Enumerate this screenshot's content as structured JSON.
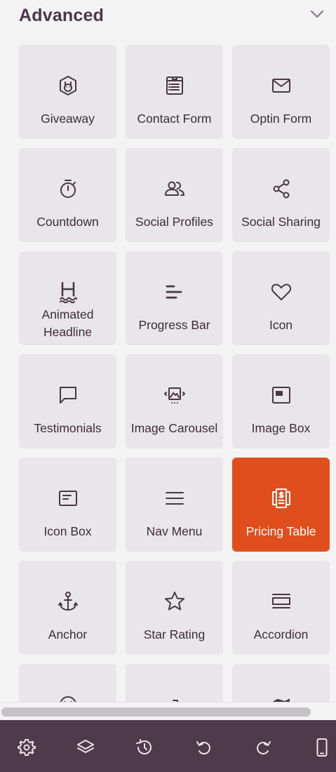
{
  "section": {
    "title": "Advanced",
    "collapse_icon": "chevron-down-icon"
  },
  "blocks": [
    {
      "label": "Giveaway",
      "icon": "giveaway-icon",
      "active": false
    },
    {
      "label": "Contact Form",
      "icon": "contact-form-icon",
      "active": false
    },
    {
      "label": "Optin Form",
      "icon": "envelope-icon",
      "active": false
    },
    {
      "label": "Countdown",
      "icon": "stopwatch-icon",
      "active": false
    },
    {
      "label": "Social Profiles",
      "icon": "people-icon",
      "active": false
    },
    {
      "label": "Social Sharing",
      "icon": "share-icon",
      "active": false
    },
    {
      "label_lines": [
        "Animated",
        "Headline"
      ],
      "icon": "animated-headline-icon",
      "active": false
    },
    {
      "label": "Progress Bar",
      "icon": "progress-bar-icon",
      "active": false
    },
    {
      "label": "Icon",
      "icon": "heart-icon",
      "active": false
    },
    {
      "label": "Testimonials",
      "icon": "speech-bubble-icon",
      "active": false
    },
    {
      "label": "Image Carousel",
      "icon": "image-carousel-icon",
      "active": false
    },
    {
      "label": "Image Box",
      "icon": "image-box-icon",
      "active": false
    },
    {
      "label": "Icon Box",
      "icon": "icon-box-icon",
      "active": false
    },
    {
      "label": "Nav Menu",
      "icon": "hamburger-menu-icon",
      "active": false
    },
    {
      "label": "Pricing Table",
      "icon": "pricing-table-icon",
      "active": true
    },
    {
      "label": "Anchor",
      "icon": "anchor-icon",
      "active": false
    },
    {
      "label": "Star Rating",
      "icon": "star-icon",
      "active": false
    },
    {
      "label": "Accordion",
      "icon": "accordion-icon",
      "active": false
    },
    {
      "label": "",
      "icon": "partial-icon-1",
      "active": false
    },
    {
      "label": "",
      "icon": "partial-icon-2",
      "active": false
    },
    {
      "label": "",
      "icon": "partial-icon-3",
      "active": false
    }
  ],
  "toolbar": {
    "buttons": [
      {
        "name": "settings-button",
        "icon": "gear-icon"
      },
      {
        "name": "layers-button",
        "icon": "layers-icon"
      },
      {
        "name": "history-button",
        "icon": "history-icon"
      },
      {
        "name": "undo-button",
        "icon": "undo-icon"
      },
      {
        "name": "redo-button",
        "icon": "redo-icon"
      },
      {
        "name": "mobile-preview-button",
        "icon": "mobile-device-icon"
      }
    ]
  },
  "colors": {
    "accent": "#e14e1e",
    "toolbar_bg": "#4f3a4c",
    "tile_bg": "#e8e6e9",
    "panel_bg": "#f4f3f4",
    "text": "#3f2c3a"
  }
}
